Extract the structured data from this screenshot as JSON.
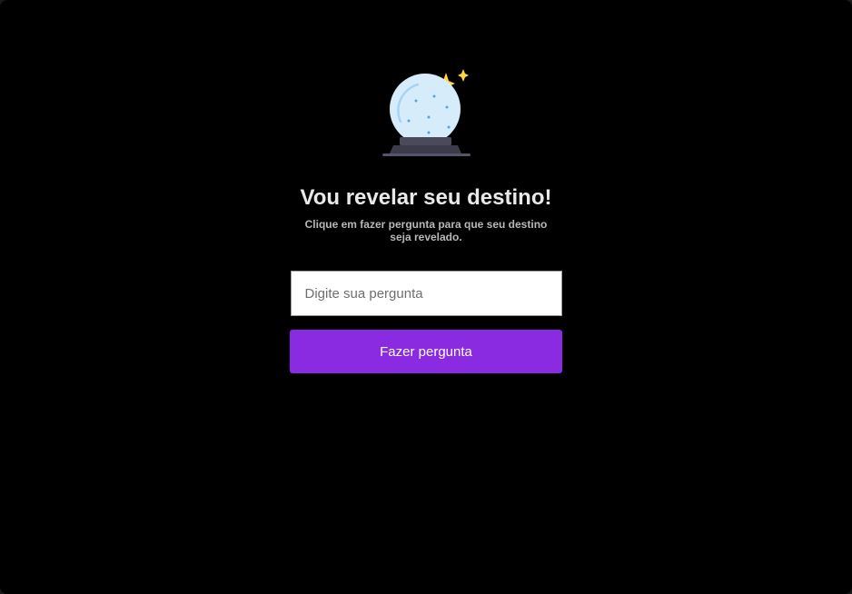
{
  "hero": {
    "icon": "crystal-ball-icon",
    "title": "Vou revelar seu destino!",
    "subtitle": "Clique em fazer pergunta para que seu destino seja revelado."
  },
  "form": {
    "question_placeholder": "Digite sua pergunta",
    "question_value": "",
    "ask_button_label": "Fazer pergunta"
  },
  "colors": {
    "background": "#000000",
    "accent": "#8a2be2",
    "title_text": "#e9e9e9",
    "subtitle_text": "#b8b8b8",
    "sparkle": "#ffd93d",
    "ball_glass": "#d7ecfb"
  }
}
